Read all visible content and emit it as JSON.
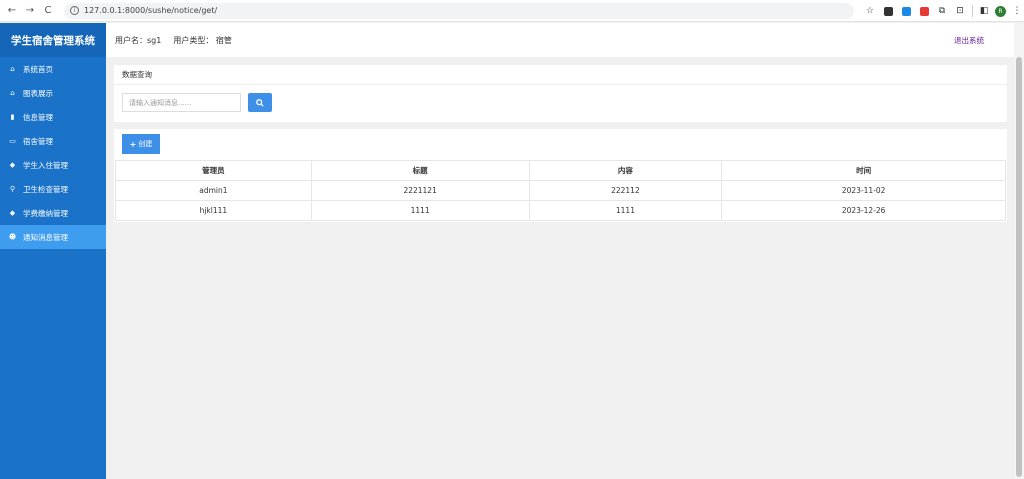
{
  "browser": {
    "url": "127.0.0.1:8000/sushe/notice/get/",
    "avatar_letter": "R"
  },
  "sidebar": {
    "brand": "学生宿舍管理系统",
    "items": [
      {
        "label": "系统首页",
        "icon": "home-icon"
      },
      {
        "label": "图表展示",
        "icon": "home-icon"
      },
      {
        "label": "信息管理",
        "icon": "document-icon"
      },
      {
        "label": "宿舍管理",
        "icon": "id-card-icon"
      },
      {
        "label": "学生入住管理",
        "icon": "diamond-icon"
      },
      {
        "label": "卫生检查管理",
        "icon": "broom-icon"
      },
      {
        "label": "学费缴纳管理",
        "icon": "diamond-icon"
      },
      {
        "label": "通知消息管理",
        "icon": "users-icon"
      }
    ],
    "active_index": 7
  },
  "header": {
    "username": "用户名：sg1",
    "usertype": "用户类型：  宿管",
    "logout_label": "退出系统"
  },
  "search": {
    "panel_title": "数据查询",
    "placeholder": "请输入通知消息......"
  },
  "create_label": "创建",
  "table": {
    "headers": [
      "管理员",
      "标题",
      "内容",
      "时间"
    ],
    "rows": [
      [
        "admin1",
        "2221121",
        "222112",
        "2023-11-02"
      ],
      [
        "hjkl111",
        "1111",
        "1111",
        "2023-12-26"
      ]
    ]
  },
  "colors": {
    "sidebar_bg": "#1a73c9",
    "brand_bg": "#1565b8",
    "active_item": "#3f9df0",
    "primary_button": "#3d8fe8",
    "logout_link": "#6a1b9a"
  }
}
